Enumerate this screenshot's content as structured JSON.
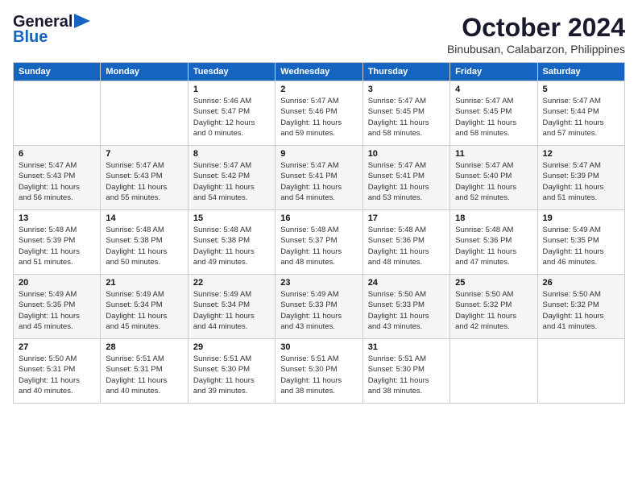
{
  "logo": {
    "line1": "General",
    "line2": "Blue"
  },
  "title": "October 2024",
  "subtitle": "Binubusan, Calabarzon, Philippines",
  "headers": [
    "Sunday",
    "Monday",
    "Tuesday",
    "Wednesday",
    "Thursday",
    "Friday",
    "Saturday"
  ],
  "weeks": [
    [
      {
        "day": "",
        "content": ""
      },
      {
        "day": "",
        "content": ""
      },
      {
        "day": "1",
        "content": "Sunrise: 5:46 AM\nSunset: 5:47 PM\nDaylight: 12 hours\nand 0 minutes."
      },
      {
        "day": "2",
        "content": "Sunrise: 5:47 AM\nSunset: 5:46 PM\nDaylight: 11 hours\nand 59 minutes."
      },
      {
        "day": "3",
        "content": "Sunrise: 5:47 AM\nSunset: 5:45 PM\nDaylight: 11 hours\nand 58 minutes."
      },
      {
        "day": "4",
        "content": "Sunrise: 5:47 AM\nSunset: 5:45 PM\nDaylight: 11 hours\nand 58 minutes."
      },
      {
        "day": "5",
        "content": "Sunrise: 5:47 AM\nSunset: 5:44 PM\nDaylight: 11 hours\nand 57 minutes."
      }
    ],
    [
      {
        "day": "6",
        "content": "Sunrise: 5:47 AM\nSunset: 5:43 PM\nDaylight: 11 hours\nand 56 minutes."
      },
      {
        "day": "7",
        "content": "Sunrise: 5:47 AM\nSunset: 5:43 PM\nDaylight: 11 hours\nand 55 minutes."
      },
      {
        "day": "8",
        "content": "Sunrise: 5:47 AM\nSunset: 5:42 PM\nDaylight: 11 hours\nand 54 minutes."
      },
      {
        "day": "9",
        "content": "Sunrise: 5:47 AM\nSunset: 5:41 PM\nDaylight: 11 hours\nand 54 minutes."
      },
      {
        "day": "10",
        "content": "Sunrise: 5:47 AM\nSunset: 5:41 PM\nDaylight: 11 hours\nand 53 minutes."
      },
      {
        "day": "11",
        "content": "Sunrise: 5:47 AM\nSunset: 5:40 PM\nDaylight: 11 hours\nand 52 minutes."
      },
      {
        "day": "12",
        "content": "Sunrise: 5:47 AM\nSunset: 5:39 PM\nDaylight: 11 hours\nand 51 minutes."
      }
    ],
    [
      {
        "day": "13",
        "content": "Sunrise: 5:48 AM\nSunset: 5:39 PM\nDaylight: 11 hours\nand 51 minutes."
      },
      {
        "day": "14",
        "content": "Sunrise: 5:48 AM\nSunset: 5:38 PM\nDaylight: 11 hours\nand 50 minutes."
      },
      {
        "day": "15",
        "content": "Sunrise: 5:48 AM\nSunset: 5:38 PM\nDaylight: 11 hours\nand 49 minutes."
      },
      {
        "day": "16",
        "content": "Sunrise: 5:48 AM\nSunset: 5:37 PM\nDaylight: 11 hours\nand 48 minutes."
      },
      {
        "day": "17",
        "content": "Sunrise: 5:48 AM\nSunset: 5:36 PM\nDaylight: 11 hours\nand 48 minutes."
      },
      {
        "day": "18",
        "content": "Sunrise: 5:48 AM\nSunset: 5:36 PM\nDaylight: 11 hours\nand 47 minutes."
      },
      {
        "day": "19",
        "content": "Sunrise: 5:49 AM\nSunset: 5:35 PM\nDaylight: 11 hours\nand 46 minutes."
      }
    ],
    [
      {
        "day": "20",
        "content": "Sunrise: 5:49 AM\nSunset: 5:35 PM\nDaylight: 11 hours\nand 45 minutes."
      },
      {
        "day": "21",
        "content": "Sunrise: 5:49 AM\nSunset: 5:34 PM\nDaylight: 11 hours\nand 45 minutes."
      },
      {
        "day": "22",
        "content": "Sunrise: 5:49 AM\nSunset: 5:34 PM\nDaylight: 11 hours\nand 44 minutes."
      },
      {
        "day": "23",
        "content": "Sunrise: 5:49 AM\nSunset: 5:33 PM\nDaylight: 11 hours\nand 43 minutes."
      },
      {
        "day": "24",
        "content": "Sunrise: 5:50 AM\nSunset: 5:33 PM\nDaylight: 11 hours\nand 43 minutes."
      },
      {
        "day": "25",
        "content": "Sunrise: 5:50 AM\nSunset: 5:32 PM\nDaylight: 11 hours\nand 42 minutes."
      },
      {
        "day": "26",
        "content": "Sunrise: 5:50 AM\nSunset: 5:32 PM\nDaylight: 11 hours\nand 41 minutes."
      }
    ],
    [
      {
        "day": "27",
        "content": "Sunrise: 5:50 AM\nSunset: 5:31 PM\nDaylight: 11 hours\nand 40 minutes."
      },
      {
        "day": "28",
        "content": "Sunrise: 5:51 AM\nSunset: 5:31 PM\nDaylight: 11 hours\nand 40 minutes."
      },
      {
        "day": "29",
        "content": "Sunrise: 5:51 AM\nSunset: 5:30 PM\nDaylight: 11 hours\nand 39 minutes."
      },
      {
        "day": "30",
        "content": "Sunrise: 5:51 AM\nSunset: 5:30 PM\nDaylight: 11 hours\nand 38 minutes."
      },
      {
        "day": "31",
        "content": "Sunrise: 5:51 AM\nSunset: 5:30 PM\nDaylight: 11 hours\nand 38 minutes."
      },
      {
        "day": "",
        "content": ""
      },
      {
        "day": "",
        "content": ""
      }
    ]
  ]
}
